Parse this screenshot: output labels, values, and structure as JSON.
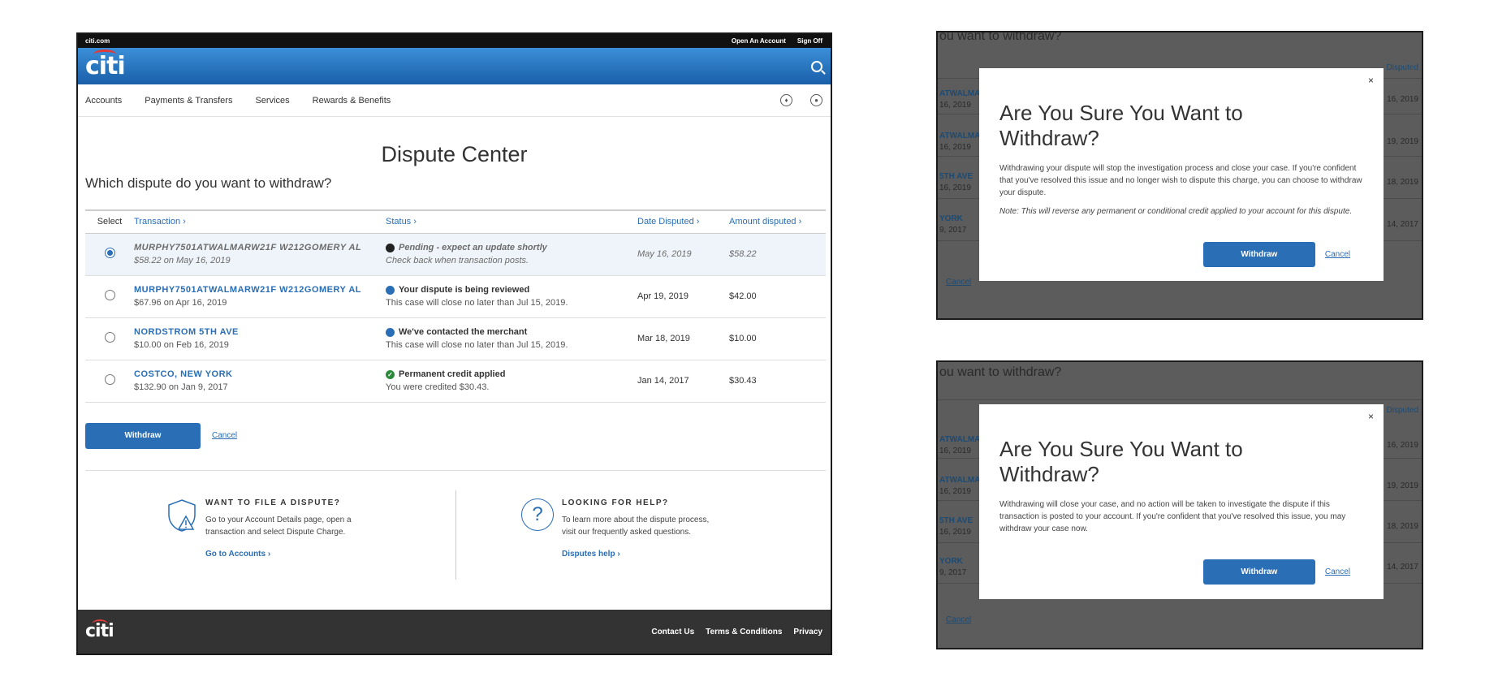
{
  "topbar": {
    "site": "citi.com",
    "open_account": "Open An Account",
    "sign_off": "Sign Off"
  },
  "brand": {
    "logo": "citi"
  },
  "nav": {
    "items": [
      "Accounts",
      "Payments & Transfers",
      "Services",
      "Rewards & Benefits"
    ]
  },
  "page": {
    "title": "Dispute Center",
    "question": "Which dispute do you want to withdraw?"
  },
  "table": {
    "headers": {
      "select": "Select",
      "transaction": "Transaction ›",
      "status": "Status ›",
      "date": "Date Disputed ›",
      "amount": "Amount disputed ›"
    },
    "rows": [
      {
        "name": "MURPHY7501ATWALMARW21F W212GOMERY AL",
        "sub": "$58.22 on May 16, 2019",
        "status": "Pending - expect an update shortly",
        "status_sub": "Check back when transaction posts.",
        "date": "May 16, 2019",
        "amount": "$58.22"
      },
      {
        "name": "MURPHY7501ATWALMARW21F W212GOMERY AL",
        "sub": "$67.96 on Apr 16, 2019",
        "status": "Your dispute is being reviewed",
        "status_sub": "This case will close no later than Jul 15, 2019.",
        "date": "Apr 19, 2019",
        "amount": "$42.00"
      },
      {
        "name": "NORDSTROM 5TH AVE",
        "sub": "$10.00 on Feb 16, 2019",
        "status": "We've contacted the merchant",
        "status_sub": "This case will close no later than Jul 15, 2019.",
        "date": "Mar 18, 2019",
        "amount": "$10.00"
      },
      {
        "name": "COSTCO, NEW YORK",
        "sub": "$132.90 on Jan 9, 2017",
        "status": "Permanent credit applied",
        "status_sub": "You were credited $30.43.",
        "date": "Jan 14, 2017",
        "amount": "$30.43"
      }
    ]
  },
  "actions": {
    "withdraw": "Withdraw",
    "cancel": "Cancel"
  },
  "help": {
    "file": {
      "title": "WANT TO FILE A DISPUTE?",
      "text": "Go to your Account Details page, open a transaction and select Dispute Charge.",
      "link": "Go to Accounts ›"
    },
    "looking": {
      "title": "LOOKING FOR HELP?",
      "text": "To learn more about the dispute process, visit our frequently asked questions.",
      "link": "Disputes help ›"
    }
  },
  "footer": {
    "logo": "citi",
    "contact": "Contact Us",
    "terms": "Terms & Conditions",
    "privacy": "Privacy"
  },
  "modal1": {
    "bg_question": "ou want to withdraw?",
    "bg_header": "Disputed",
    "bg_rows": [
      {
        "name": "ATWALMA",
        "date": "16, 2019",
        "right": "16, 2019"
      },
      {
        "name": "ATWALMA",
        "date": "16, 2019",
        "right": "19, 2019"
      },
      {
        "name": "5TH AVE",
        "date": "16, 2019",
        "right": "18, 2019"
      },
      {
        "name": "YORK",
        "date": "9, 2017",
        "right": "14, 2017"
      }
    ],
    "bg_cancel": "Cancel",
    "close": "×",
    "title": "Are You Sure You Want to Withdraw?",
    "body": "Withdrawing your dispute will stop the investigation process and close your case. If you're confident that you've resolved this issue and no longer wish to dispute this charge, you can choose to withdraw your dispute.",
    "note": "Note: This will reverse any permanent or conditional credit applied to your account for this dispute.",
    "withdraw": "Withdraw",
    "cancel": "Cancel"
  },
  "modal2": {
    "bg_question": "ou want to withdraw?",
    "bg_header": "Disputed",
    "bg_rows": [
      {
        "name": "ATWALMA",
        "date": "16, 2019",
        "right": "16, 2019"
      },
      {
        "name": "ATWALMA",
        "date": "16, 2019",
        "right": "19, 2019"
      },
      {
        "name": "5TH AVE",
        "date": "16, 2019",
        "right": "18, 2019"
      },
      {
        "name": "YORK",
        "date": "9, 2017",
        "right": "14, 2017"
      }
    ],
    "bg_cancel": "Cancel",
    "close": "×",
    "title": "Are You Sure You Want to Withdraw?",
    "body": "Withdrawing will close your case, and no action will be taken to investigate the dispute if this transaction is posted to your account. If you're confident that you've resolved this issue, you may withdraw your case now.",
    "withdraw": "Withdraw",
    "cancel": "Cancel"
  }
}
